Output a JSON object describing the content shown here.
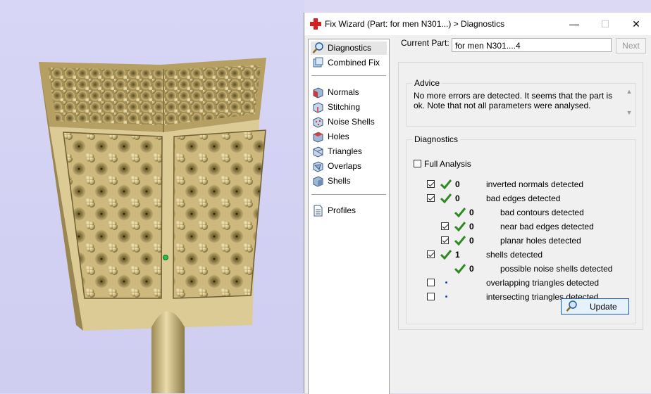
{
  "window": {
    "title": "Fix Wizard (Part: for men N301...) > Diagnostics",
    "controls": {
      "minimize": "—",
      "maximize": "☐",
      "close": "✕"
    }
  },
  "nav": {
    "items": [
      {
        "label": "Diagnostics",
        "icon": "magnifier-icon",
        "selected": true
      },
      {
        "label": "Combined Fix",
        "icon": "combined-fix-icon"
      },
      {
        "label": "Normals",
        "icon": "normals-cube-icon"
      },
      {
        "label": "Stitching",
        "icon": "stitching-cube-icon"
      },
      {
        "label": "Noise Shells",
        "icon": "noise-shells-icon"
      },
      {
        "label": "Holes",
        "icon": "holes-cube-icon"
      },
      {
        "label": "Triangles",
        "icon": "triangles-cube-icon"
      },
      {
        "label": "Overlaps",
        "icon": "overlaps-cube-icon"
      },
      {
        "label": "Shells",
        "icon": "shells-cube-icon"
      },
      {
        "label": "Profiles",
        "icon": "profiles-document-icon"
      }
    ]
  },
  "current_part": {
    "label": "Current Part:",
    "value": "for men N301....4"
  },
  "next_button": "Next",
  "advice": {
    "title": "Advice",
    "text": "No more errors are detected. It seems that the part is ok. Note that not all parameters were analysed."
  },
  "diagnostics": {
    "title": "Diagnostics",
    "full_analysis": {
      "label": "Full Analysis",
      "checked": false
    },
    "rows": [
      {
        "checkbox": true,
        "checked": true,
        "status": "tick",
        "count": "0",
        "label": "inverted normals detected"
      },
      {
        "checkbox": true,
        "checked": true,
        "status": "tick",
        "count": "0",
        "label": "bad edges detected"
      },
      {
        "checkbox": false,
        "status": "tick",
        "count": "0",
        "label": "bad contours detected"
      },
      {
        "checkbox": true,
        "checked": true,
        "status": "tick",
        "count": "0",
        "label": "near bad edges detected"
      },
      {
        "checkbox": true,
        "checked": true,
        "status": "tick",
        "count": "0",
        "label": "planar holes detected"
      },
      {
        "checkbox": true,
        "checked": true,
        "status": "tick",
        "count": "1",
        "label": "shells detected"
      },
      {
        "checkbox": false,
        "status": "tick",
        "count": "0",
        "label": "possible noise shells detected"
      },
      {
        "checkbox": true,
        "checked": false,
        "status": "dot",
        "count": "",
        "label": "overlapping triangles detected"
      },
      {
        "checkbox": true,
        "checked": false,
        "status": "dot",
        "count": "",
        "label": "intersecting triangles detected"
      }
    ]
  },
  "update_button": "Update",
  "colors": {
    "tick": "#2e8b22",
    "accent": "#1e5aa8",
    "model": "#c9b47a"
  }
}
